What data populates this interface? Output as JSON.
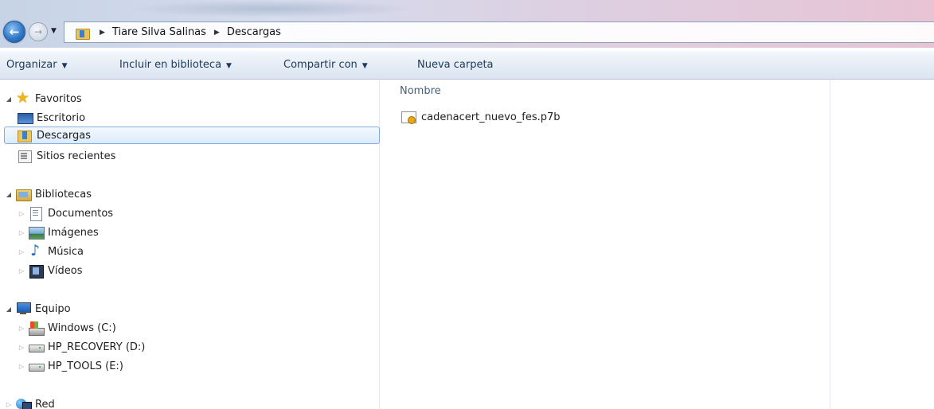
{
  "window": {
    "breadcrumbs": [
      "Tiare Silva Salinas",
      "Descargas"
    ]
  },
  "toolbar": {
    "organize": "Organizar",
    "include_library": "Incluir en biblioteca",
    "share_with": "Compartir con",
    "new_folder": "Nueva carpeta"
  },
  "nav": {
    "favorites": {
      "label": "Favoritos",
      "items": [
        "Escritorio",
        "Descargas",
        "Sitios recientes"
      ]
    },
    "libraries": {
      "label": "Bibliotecas",
      "items": [
        "Documentos",
        "Imágenes",
        "Música",
        "Vídeos"
      ]
    },
    "computer": {
      "label": "Equipo",
      "items": [
        "Windows (C:)",
        "HP_RECOVERY (D:)",
        "HP_TOOLS (E:)"
      ]
    },
    "network": {
      "label": "Red"
    }
  },
  "content": {
    "column_name": "Nombre",
    "files": [
      {
        "name": "cadenacert_nuevo_fes.p7b",
        "icon": "certificate-icon"
      }
    ]
  },
  "colors": {
    "selection_border": "#84acdd",
    "toolbar_text": "#1e395b"
  }
}
